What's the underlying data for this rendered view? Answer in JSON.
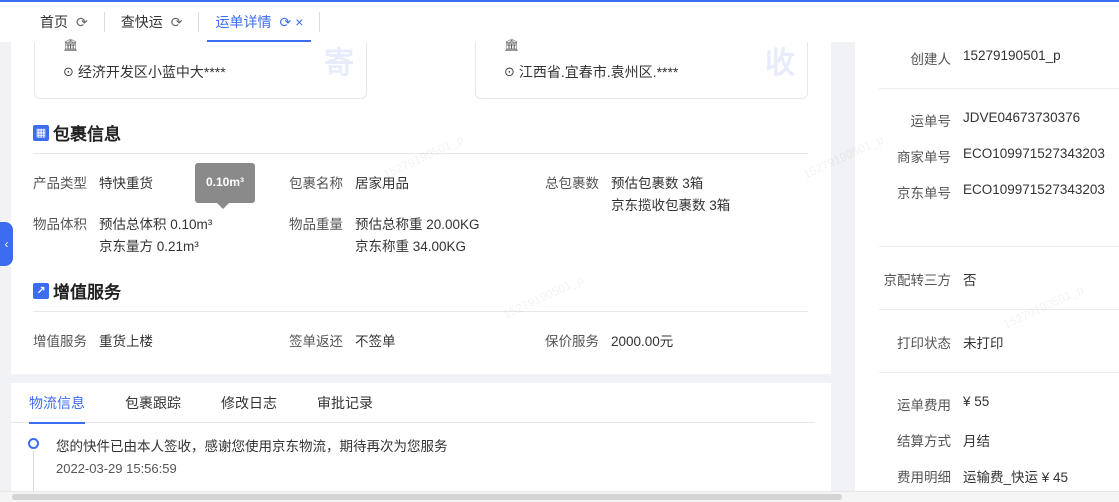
{
  "tabs": [
    {
      "label": "首页",
      "active": false,
      "closable": false
    },
    {
      "label": "查快运",
      "active": false,
      "closable": false
    },
    {
      "label": "运单详情",
      "active": true,
      "closable": true
    }
  ],
  "sender": {
    "address": "经济开发区小蓝中大****",
    "watermark": "寄"
  },
  "receiver": {
    "address": "江西省.宜春市.袁州区.****",
    "watermark": "收"
  },
  "package_section": {
    "title": "包裹信息",
    "product_type": {
      "key": "产品类型",
      "value": "特快重货"
    },
    "package_name": {
      "key": "包裹名称",
      "value": "居家用品"
    },
    "total_packages": {
      "key": "总包裹数",
      "value1": "预估包裹数 3箱",
      "value2": "京东揽收包裹数 3箱"
    },
    "volume": {
      "key": "物品体积",
      "value1": "预估总体积 0.10m³",
      "value2": "京东量方 0.21m³"
    },
    "weight": {
      "key": "物品重量",
      "value1": "预估总称重 20.00KG",
      "value2": "京东称重 34.00KG"
    },
    "tooltip": "0.10m³"
  },
  "value_added_section": {
    "title": "增值服务",
    "service": {
      "key": "增值服务",
      "value": "重货上楼"
    },
    "sign_return": {
      "key": "签单返还",
      "value": "不签单"
    },
    "insurance": {
      "key": "保价服务",
      "value": "2000.00元"
    }
  },
  "bottom_tabs": [
    "物流信息",
    "包裹跟踪",
    "修改日志",
    "审批记录"
  ],
  "timeline": {
    "text": "您的快件已由本人签收，感谢您使用京东物流，期待再次为您服务",
    "time": "2022-03-29 15:56:59"
  },
  "right_panel": {
    "creator": {
      "key": "创建人",
      "value": "15279190501_p"
    },
    "waybill_no": {
      "key": "运单号",
      "value": "JDVE04673730376"
    },
    "merchant_no": {
      "key": "商家单号",
      "value": "ECO109971527343203"
    },
    "jd_no": {
      "key": "京东单号",
      "value": "ECO109971527343203"
    },
    "third_party": {
      "key": "京配转三方",
      "value": "否"
    },
    "print_status": {
      "key": "打印状态",
      "value": "未打印"
    },
    "fee": {
      "key": "运单费用",
      "value": "¥ 55"
    },
    "settlement": {
      "key": "结算方式",
      "value": "月结"
    },
    "fee_detail": {
      "key": "费用明细",
      "value": "运输费_快运 ¥ 45"
    }
  },
  "watermark_text": "15279190501_p",
  "colors": {
    "accent": "#3c6df0"
  }
}
